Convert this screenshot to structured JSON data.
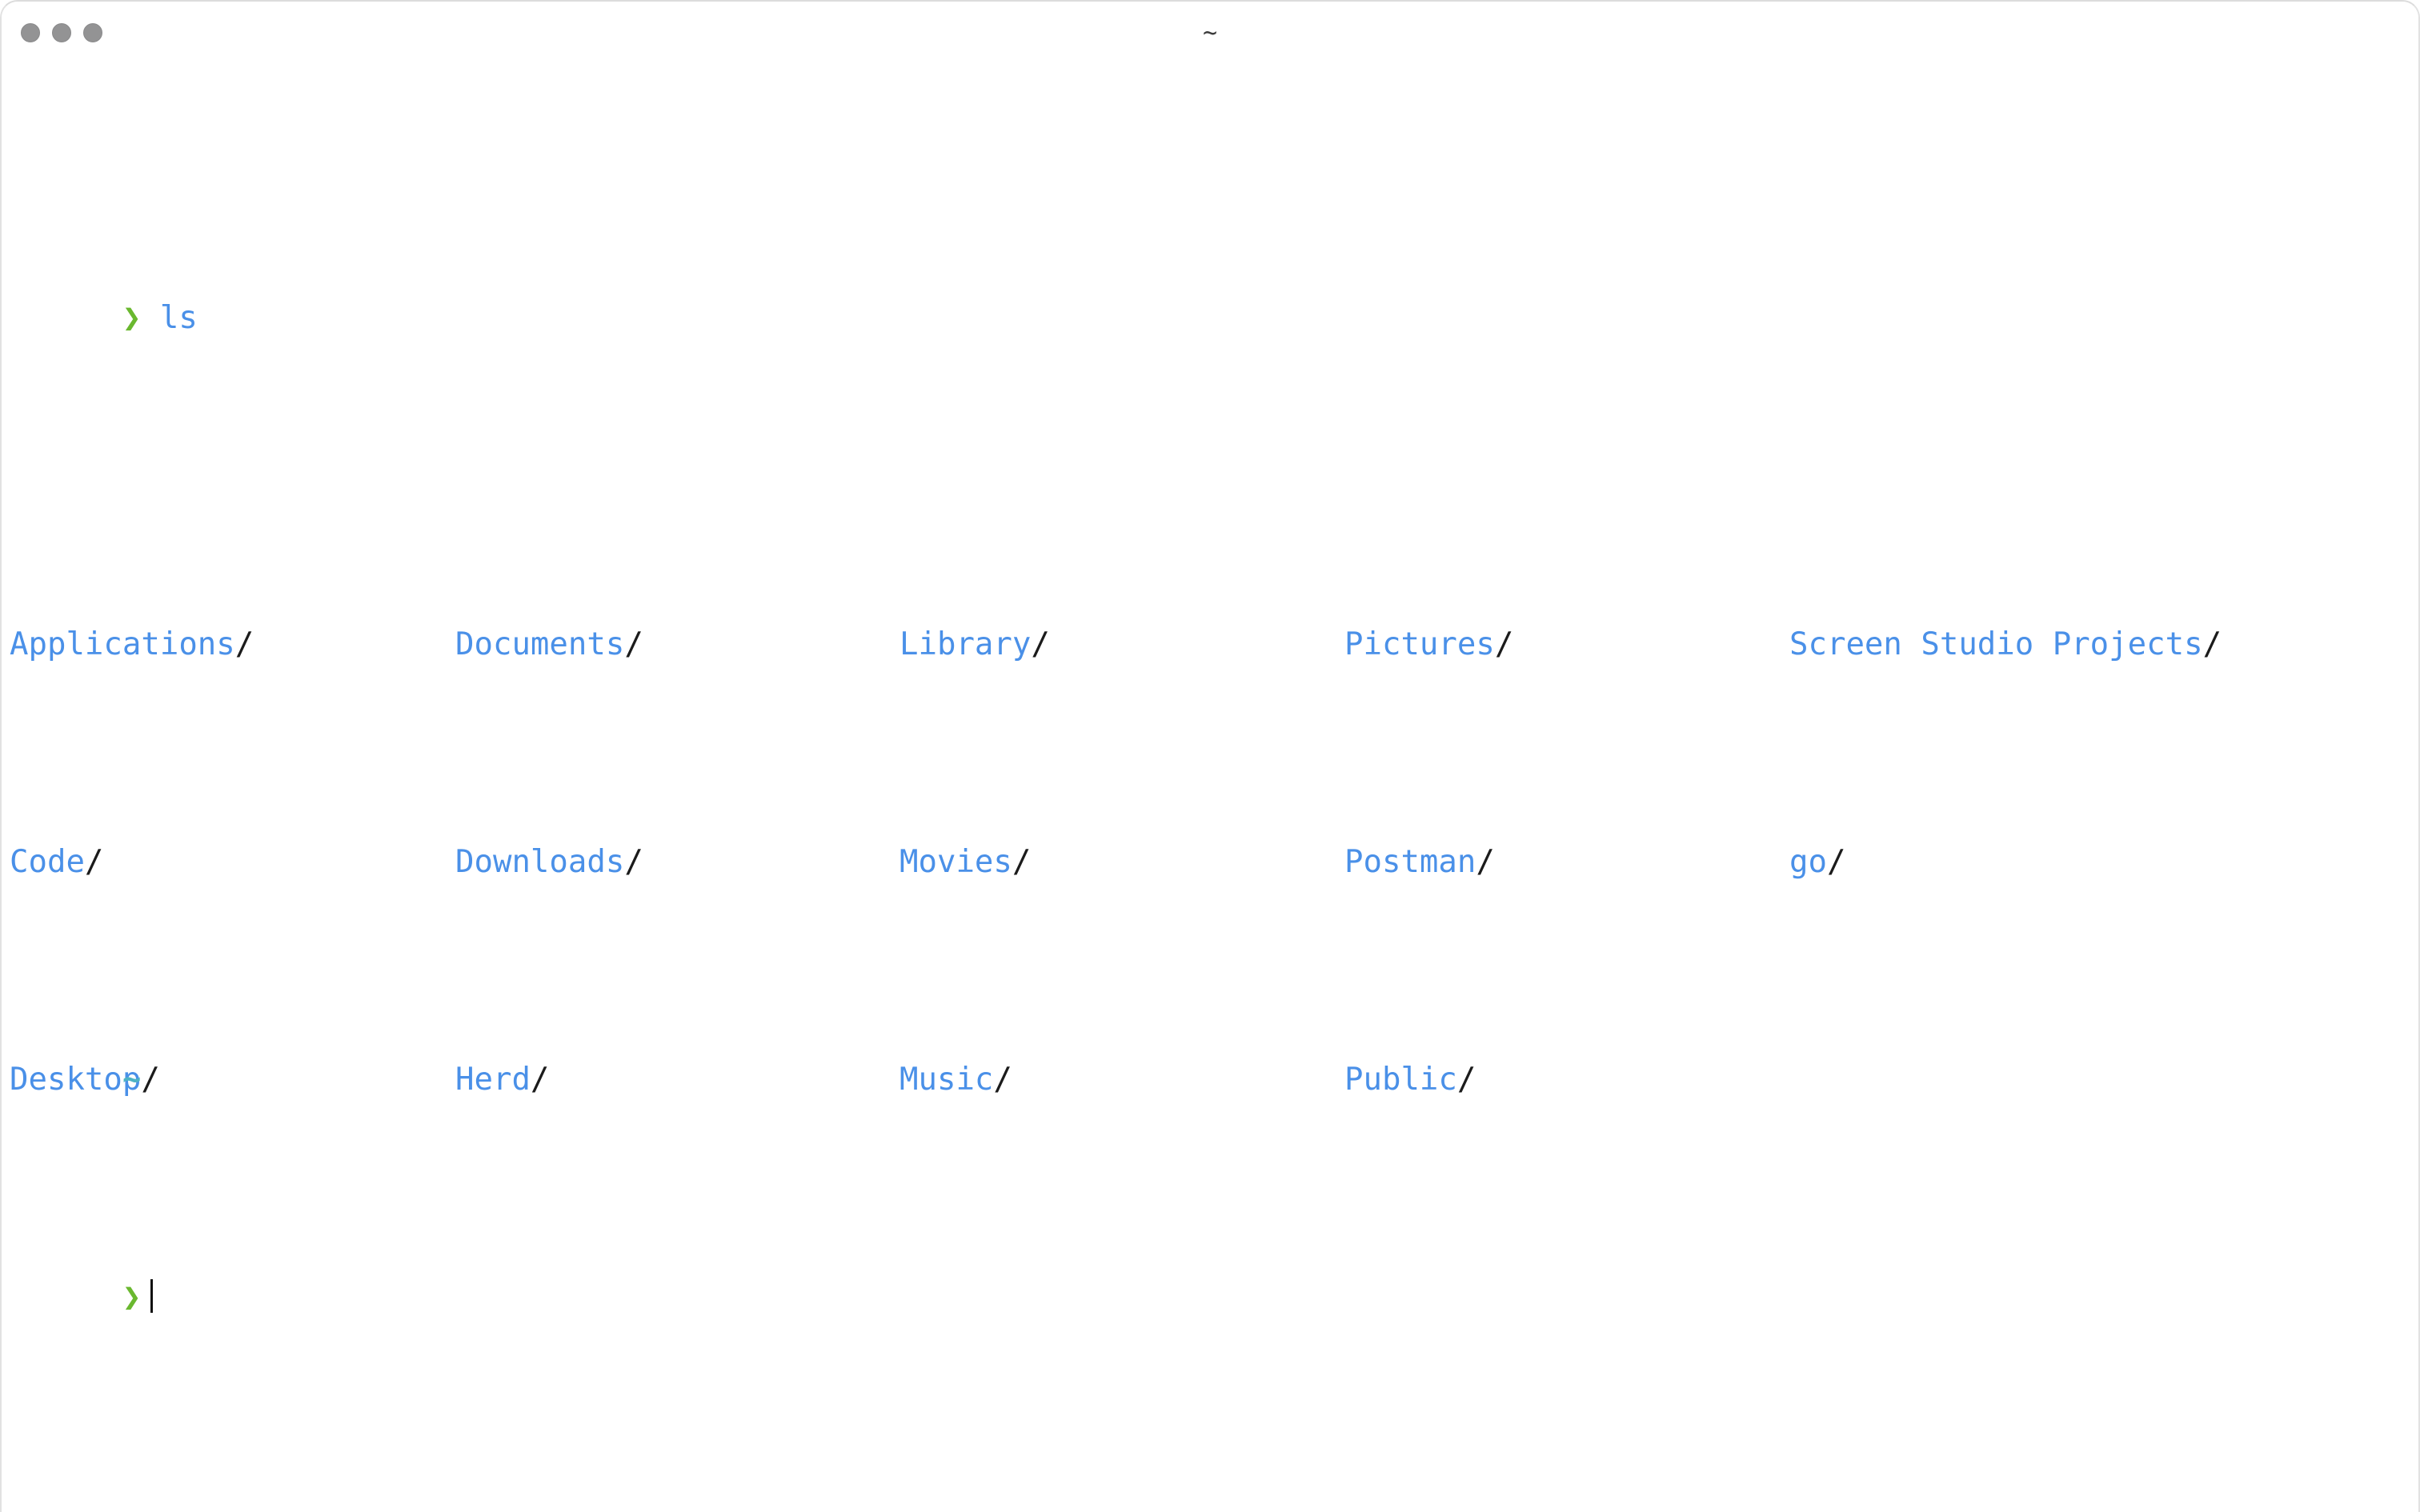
{
  "window": {
    "title": "~",
    "traffic_lights": [
      {
        "name": "close",
        "color": "#939394"
      },
      {
        "name": "minimize",
        "color": "#939394"
      },
      {
        "name": "zoom",
        "color": "#939394"
      }
    ],
    "background": "#ffffff"
  },
  "theme": {
    "prompt_green": "#6AB82F",
    "dir_blue": "#4A90E8",
    "slash_dark": "#1b1b1b",
    "path_cyan": "#4EB3C4",
    "cursor": "#111111",
    "title_gray": "#3b3b3b"
  },
  "terminal": {
    "prompt_symbol": "❯",
    "command_line": {
      "prompt": "❯",
      "command": "ls"
    },
    "ls_output": {
      "columns": 5,
      "column_x": [
        10,
        567,
        1122,
        1678,
        2234
      ],
      "rows": [
        [
          {
            "name": "Applications",
            "suffix": "/"
          },
          {
            "name": "Documents",
            "suffix": "/"
          },
          {
            "name": "Library",
            "suffix": "/"
          },
          {
            "name": "Pictures",
            "suffix": "/"
          },
          {
            "name": "Screen Studio Projects",
            "suffix": "/"
          }
        ],
        [
          {
            "name": "Code",
            "suffix": "/"
          },
          {
            "name": "Downloads",
            "suffix": "/"
          },
          {
            "name": "Movies",
            "suffix": "/"
          },
          {
            "name": "Postman",
            "suffix": "/"
          },
          {
            "name": "go",
            "suffix": "/"
          }
        ],
        [
          {
            "name": "Desktop",
            "suffix": "/"
          },
          {
            "name": "Herd",
            "suffix": "/"
          },
          {
            "name": "Music",
            "suffix": "/"
          },
          {
            "name": "Public",
            "suffix": "/"
          },
          {
            "name": "",
            "suffix": ""
          }
        ]
      ]
    },
    "path_line": "~",
    "input_line": {
      "prompt": "❯",
      "value": ""
    }
  }
}
